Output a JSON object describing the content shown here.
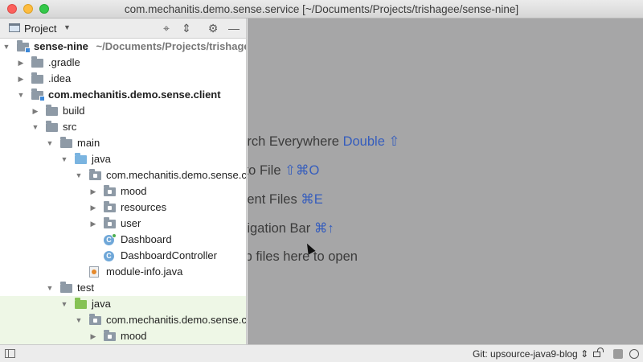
{
  "window": {
    "title": "com.mechanitis.demo.sense.service [~/Documents/Projects/trishagee/sense-nine]"
  },
  "project_panel": {
    "title": "Project",
    "dropdown_icon": "caret-down",
    "tools": [
      "target-icon",
      "collapse-icon",
      "gear-icon",
      "hide-icon"
    ]
  },
  "tree": [
    {
      "label": "sense-nine",
      "path": "~/Documents/Projects/trishagee/sense-nine",
      "depth": 0,
      "expanded": true,
      "icon": "module-folder",
      "bold": true
    },
    {
      "label": ".gradle",
      "depth": 1,
      "expanded": false,
      "icon": "folder"
    },
    {
      "label": ".idea",
      "depth": 1,
      "expanded": false,
      "icon": "folder"
    },
    {
      "label": "com.mechanitis.demo.sense.client",
      "depth": 1,
      "expanded": true,
      "icon": "module-folder",
      "bold": true
    },
    {
      "label": "build",
      "depth": 2,
      "expanded": false,
      "icon": "folder"
    },
    {
      "label": "src",
      "depth": 2,
      "expanded": true,
      "icon": "folder"
    },
    {
      "label": "main",
      "depth": 3,
      "expanded": true,
      "icon": "folder"
    },
    {
      "label": "java",
      "depth": 4,
      "expanded": true,
      "icon": "source-folder"
    },
    {
      "label": "com.mechanitis.demo.sense.client",
      "depth": 5,
      "expanded": true,
      "icon": "package"
    },
    {
      "label": "mood",
      "depth": 6,
      "expanded": false,
      "icon": "package"
    },
    {
      "label": "resources",
      "depth": 6,
      "expanded": false,
      "icon": "package"
    },
    {
      "label": "user",
      "depth": 6,
      "expanded": false,
      "icon": "package"
    },
    {
      "label": "Dashboard",
      "depth": 6,
      "icon": "class-runnable"
    },
    {
      "label": "DashboardController",
      "depth": 6,
      "icon": "class"
    },
    {
      "label": "module-info.java",
      "depth": 5,
      "icon": "java-file"
    },
    {
      "label": "test",
      "depth": 3,
      "expanded": true,
      "icon": "folder"
    },
    {
      "label": "java",
      "depth": 4,
      "expanded": true,
      "icon": "test-folder",
      "highlight": true
    },
    {
      "label": "com.mechanitis.demo.sense.client",
      "depth": 5,
      "expanded": true,
      "icon": "package",
      "highlight": true
    },
    {
      "label": "mood",
      "depth": 6,
      "expanded": false,
      "icon": "package",
      "highlight": true
    }
  ],
  "editor_hints": [
    {
      "text": "Search Everywhere",
      "key": "Double ⇧"
    },
    {
      "text": "Go to File",
      "key": "⇧⌘O"
    },
    {
      "text": "Recent Files",
      "key": "⌘E"
    },
    {
      "text": "Navigation Bar",
      "key": "⌘↑"
    },
    {
      "text": "Drop files here to open",
      "key": ""
    }
  ],
  "status_bar": {
    "git_branch": "Git: upsource-java9-blog ⇕"
  },
  "colors": {
    "editor_bg": "#a6a6a7",
    "shortcut": "#355dbd",
    "test_highlight": "#eef7e6"
  }
}
